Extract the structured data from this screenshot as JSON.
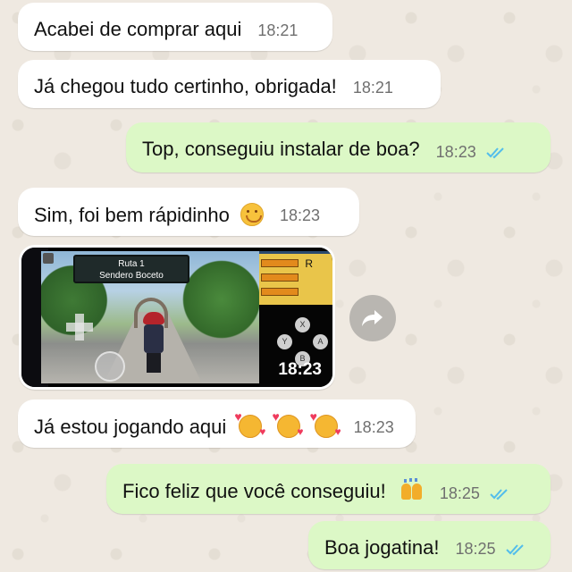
{
  "messages": [
    {
      "text": "Acabei de comprar aqui",
      "time": "18:21"
    },
    {
      "text": "Já chegou tudo certinho, obrigada!",
      "time": "18:21"
    },
    {
      "text": "Top, conseguiu instalar de boa?",
      "time": "18:23"
    },
    {
      "text": "Sim, foi bem rápidinho",
      "time": "18:23",
      "emoji": "smiling-face-icon"
    },
    {
      "image_time": "18:23",
      "game": {
        "route": "Ruta 1",
        "place": "Sendero Boceto",
        "key_r": "R",
        "buttons": [
          "X",
          "Y",
          "A",
          "B"
        ]
      }
    },
    {
      "text": "Já estou jogando aqui",
      "time": "18:23",
      "emoji": "smiling-face-with-hearts-icon"
    },
    {
      "text": "Fico feliz que você conseguiu!",
      "time": "18:25",
      "emoji": "raising-hands-icon"
    },
    {
      "text": "Boa jogatina!",
      "time": "18:25"
    }
  ],
  "colors": {
    "incoming_bubble": "#ffffff",
    "outgoing_bubble": "#dcf8c6",
    "read_ticks": "#53bdeb",
    "background": "#efeae2"
  }
}
